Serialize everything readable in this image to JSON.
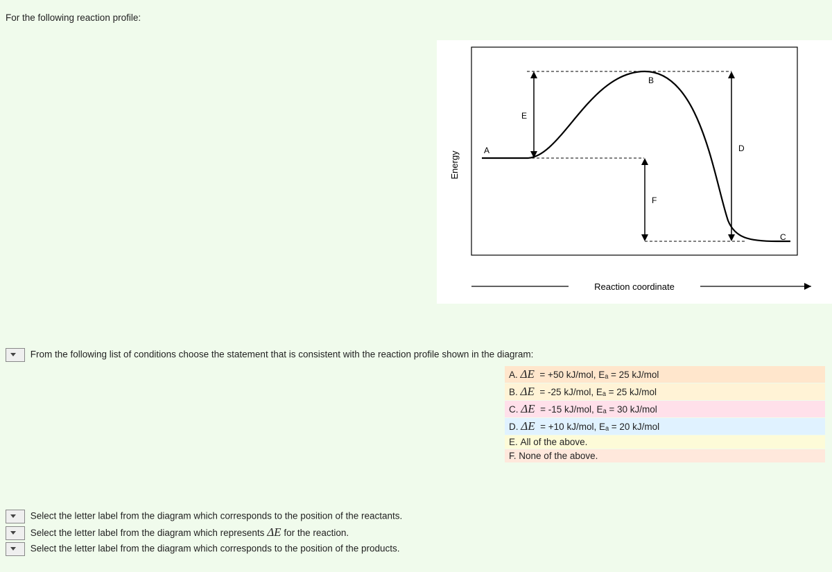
{
  "prompt": "For the following reaction profile:",
  "diagram": {
    "y_axis": "Energy",
    "x_axis": "Reaction coordinate",
    "labels": {
      "A": "A",
      "B": "B",
      "C": "C",
      "D": "D",
      "E": "E",
      "F": "F"
    }
  },
  "q1": {
    "text": "From the following list of conditions choose the statement that is consistent with the reaction profile shown in the diagram:",
    "options": {
      "A": {
        "label": "A.",
        "value": "= +50 kJ/mol, Eₐ = 25 kJ/mol"
      },
      "B": {
        "label": "B.",
        "value": "= -25 kJ/mol, Eₐ = 25 kJ/mol"
      },
      "C": {
        "label": "C.",
        "value": "= -15 kJ/mol, Eₐ = 30 kJ/mol"
      },
      "D": {
        "label": "D.",
        "value": "= +10 kJ/mol, Eₐ = 20 kJ/mol"
      },
      "E": {
        "label": "E.",
        "text": "All of the above."
      },
      "F": {
        "label": "F.",
        "text": "None of the above."
      }
    }
  },
  "q2": "Select the letter label from the diagram which corresponds to the position of the reactants.",
  "q3_pre": "Select the letter label from the diagram which represents ",
  "q3_post": " for the reaction.",
  "q4": "Select the letter label from the diagram which corresponds to the position of the products.",
  "delta_e": "ΔE"
}
